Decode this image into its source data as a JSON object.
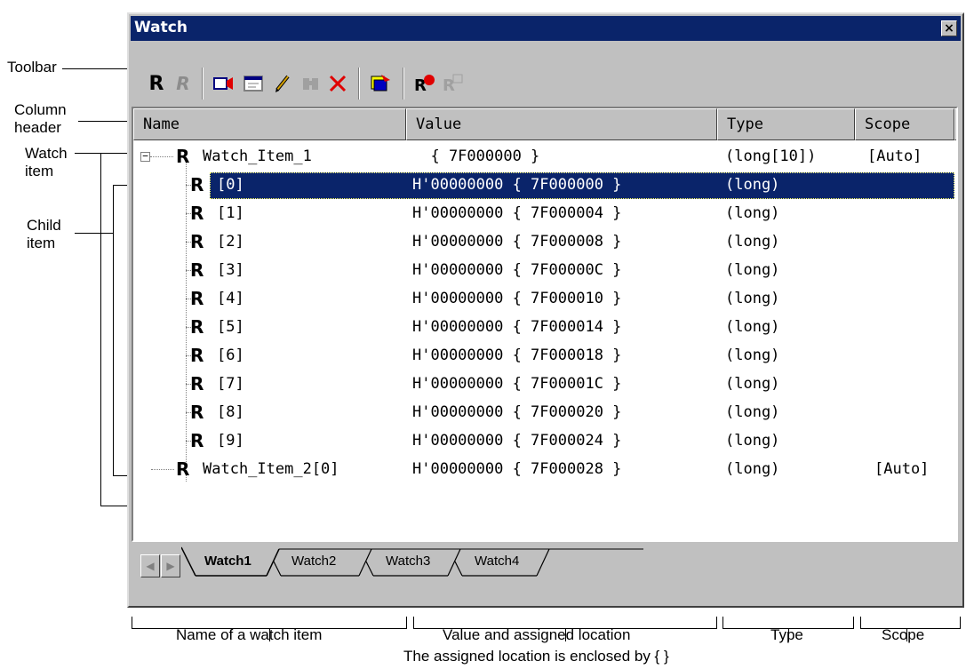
{
  "window": {
    "title": "Watch",
    "close_glyph": "×"
  },
  "toolbar_icons": [
    "register-r-icon",
    "register-r-disabled-icon",
    "record-icon",
    "edit-window-icon",
    "pencil-icon",
    "binoculars-disabled-icon",
    "delete-x-icon",
    "memory-icon",
    "refresh-register-icon",
    "register-disabled-icon"
  ],
  "columns": [
    "Name",
    "Value",
    "Type",
    "Scope"
  ],
  "items": [
    {
      "name": "Watch_Item_1",
      "value": "  { 7F000000 }",
      "type": "(long[10])",
      "scope": "[Auto]"
    },
    {
      "name": "[0]",
      "value": "H'00000000 { 7F000000 }",
      "type": "(long)",
      "scope": ""
    },
    {
      "name": "[1]",
      "value": "H'00000000 { 7F000004 }",
      "type": "(long)",
      "scope": ""
    },
    {
      "name": "[2]",
      "value": "H'00000000 { 7F000008 }",
      "type": "(long)",
      "scope": ""
    },
    {
      "name": "[3]",
      "value": "H'00000000 { 7F00000C }",
      "type": "(long)",
      "scope": ""
    },
    {
      "name": "[4]",
      "value": "H'00000000 { 7F000010 }",
      "type": "(long)",
      "scope": ""
    },
    {
      "name": "[5]",
      "value": "H'00000000 { 7F000014 }",
      "type": "(long)",
      "scope": ""
    },
    {
      "name": "[6]",
      "value": "H'00000000 { 7F000018 }",
      "type": "(long)",
      "scope": ""
    },
    {
      "name": "[7]",
      "value": "H'00000000 { 7F00001C }",
      "type": "(long)",
      "scope": ""
    },
    {
      "name": "[8]",
      "value": "H'00000000 { 7F000020 }",
      "type": "(long)",
      "scope": ""
    },
    {
      "name": "[9]",
      "value": "H'00000000 { 7F000024 }",
      "type": "(long)",
      "scope": ""
    },
    {
      "name": "Watch_Item_2[0]",
      "value": "H'00000000 { 7F000028 }",
      "type": "(long)",
      "scope": "[Auto]"
    }
  ],
  "tabs": [
    "Watch1",
    "Watch2",
    "Watch3",
    "Watch4"
  ],
  "callouts": {
    "toolbar": "Toolbar",
    "column_header": [
      "Column",
      "header"
    ],
    "watch_item": [
      "Watch",
      "item"
    ],
    "child_item": [
      "Child",
      "item"
    ]
  },
  "bottom_labels": {
    "name": "Name of a watch item",
    "value": "Value and assigned location",
    "type": "Type",
    "scope": "Scope",
    "note": "The assigned location is enclosed by { }"
  },
  "colors": {
    "titlebar": "#0a246a",
    "selection": "#0a246a",
    "face": "#c0c0c0"
  }
}
